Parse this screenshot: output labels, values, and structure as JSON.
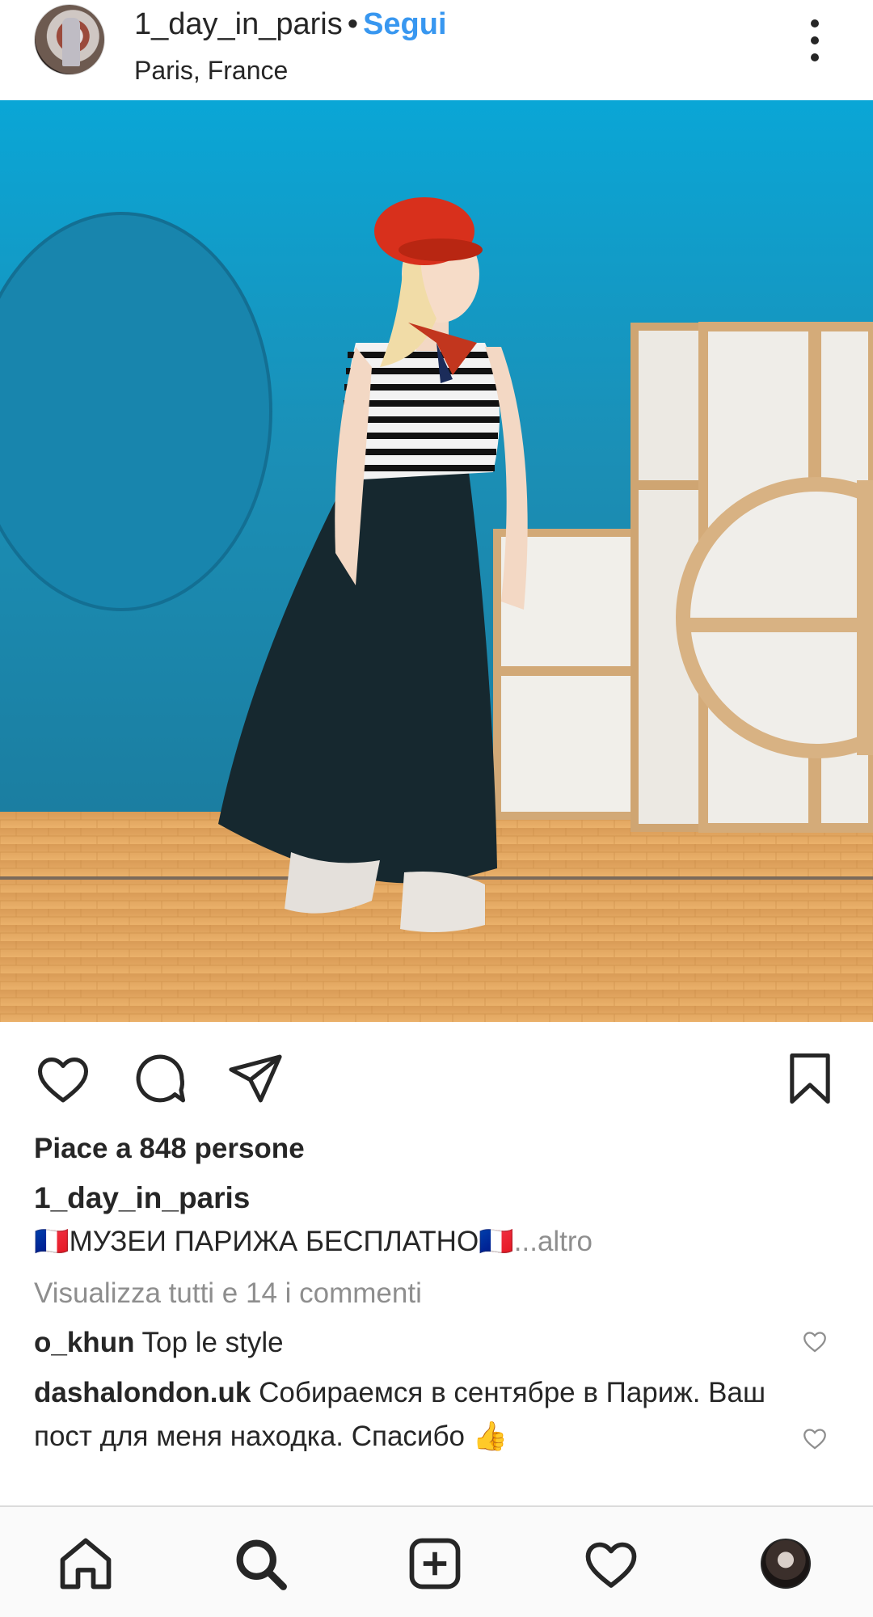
{
  "header": {
    "username": "1_day_in_paris",
    "separator": "•",
    "follow_label": "Segui",
    "location": "Paris, France",
    "more_icon": "more-vertical-icon"
  },
  "post": {
    "photo_description_icon": "post-photo"
  },
  "actions": {
    "like_icon": "heart-outline-icon",
    "comment_icon": "comment-bubble-icon",
    "share_icon": "paper-plane-icon",
    "save_icon": "bookmark-icon"
  },
  "likes_text": "Piace a 848 persone",
  "caption": {
    "username": "1_day_in_paris",
    "flag_left": "🇫🇷",
    "text": "МУЗЕИ ПАРИЖА БЕСПЛАТНО",
    "flag_right": "🇫🇷",
    "more_label": "...altro"
  },
  "view_comments_label": "Visualizza tutti e 14 i commenti",
  "comments": [
    {
      "username": "o_khun",
      "text": "Top le style"
    },
    {
      "username": "dashalondon.uk",
      "text": "Собираемся в сентябре в Париж. Ваш пост для меня находка. Спасибо 👍"
    }
  ],
  "nav": {
    "items": [
      "home-icon",
      "search-icon",
      "new-post-icon",
      "activity-heart-icon",
      "profile-avatar"
    ]
  },
  "colors": {
    "accent": "#3897f0",
    "text": "#262626",
    "muted": "#8e8e8e",
    "wall": "#1e90b8",
    "floor": "#e0a45a",
    "beret": "#d8301c"
  }
}
